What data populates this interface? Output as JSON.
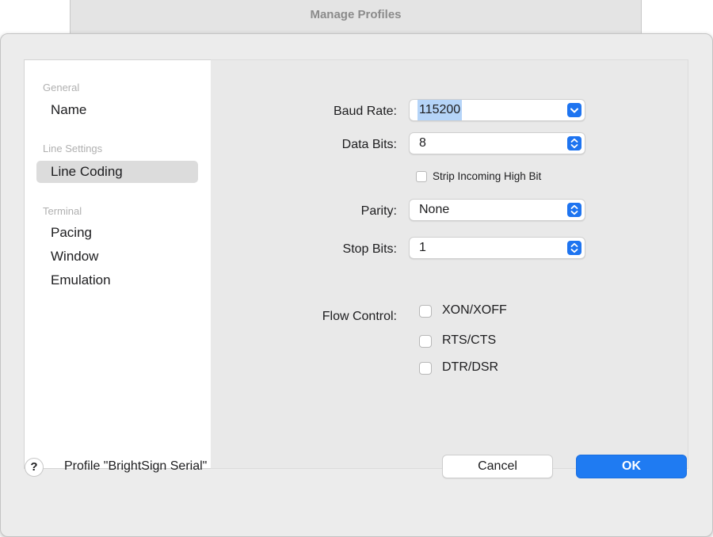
{
  "window": {
    "title": "Manage Profiles"
  },
  "sidebar": {
    "sections": [
      {
        "header": "General",
        "items": [
          "Name"
        ]
      },
      {
        "header": "Line Settings",
        "items": [
          "Line Coding"
        ]
      },
      {
        "header": "Terminal",
        "items": [
          "Pacing",
          "Window",
          "Emulation"
        ]
      }
    ],
    "selected_item": "Line Coding"
  },
  "form": {
    "baud_rate": {
      "label": "Baud Rate:",
      "value": "115200"
    },
    "data_bits": {
      "label": "Data Bits:",
      "value": "8"
    },
    "strip_high_bit": {
      "label": "Strip Incoming High Bit",
      "checked": false
    },
    "parity": {
      "label": "Parity:",
      "value": "None"
    },
    "stop_bits": {
      "label": "Stop Bits:",
      "value": "1"
    },
    "flow_control": {
      "label": "Flow Control:",
      "options": [
        {
          "label": "XON/XOFF",
          "checked": false
        },
        {
          "label": "RTS/CTS",
          "checked": false
        },
        {
          "label": "DTR/DSR",
          "checked": false
        }
      ]
    }
  },
  "footer": {
    "help_label": "?",
    "profile_text": "Profile \"BrightSign Serial\"",
    "cancel_label": "Cancel",
    "ok_label": "OK"
  },
  "colors": {
    "accent": "#1f7bf2",
    "selection": "#b5d4f8"
  }
}
